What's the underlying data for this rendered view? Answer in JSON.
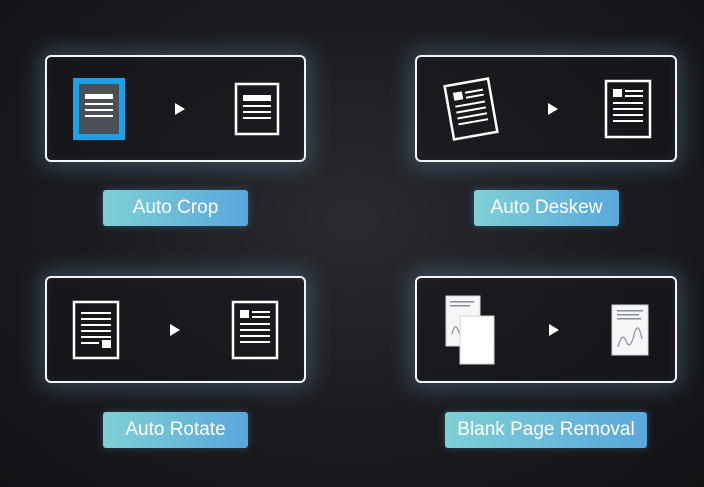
{
  "features": [
    {
      "label": "Auto Crop",
      "before_icon": "document-crop-selection-icon",
      "after_icon": "document-cropped-icon"
    },
    {
      "label": "Auto Deskew",
      "before_icon": "document-skewed-icon",
      "after_icon": "document-straight-icon"
    },
    {
      "label": "Auto Rotate",
      "before_icon": "document-rotated-icon",
      "after_icon": "document-upright-icon"
    },
    {
      "label": "Blank Page Removal",
      "before_icon": "pages-with-blank-icon",
      "after_icon": "single-page-icon"
    }
  ],
  "colors": {
    "badge_start": "#7fd0d6",
    "badge_end": "#5aa7dc",
    "crop_highlight": "#1aa3e8",
    "line": "#ffffff"
  }
}
